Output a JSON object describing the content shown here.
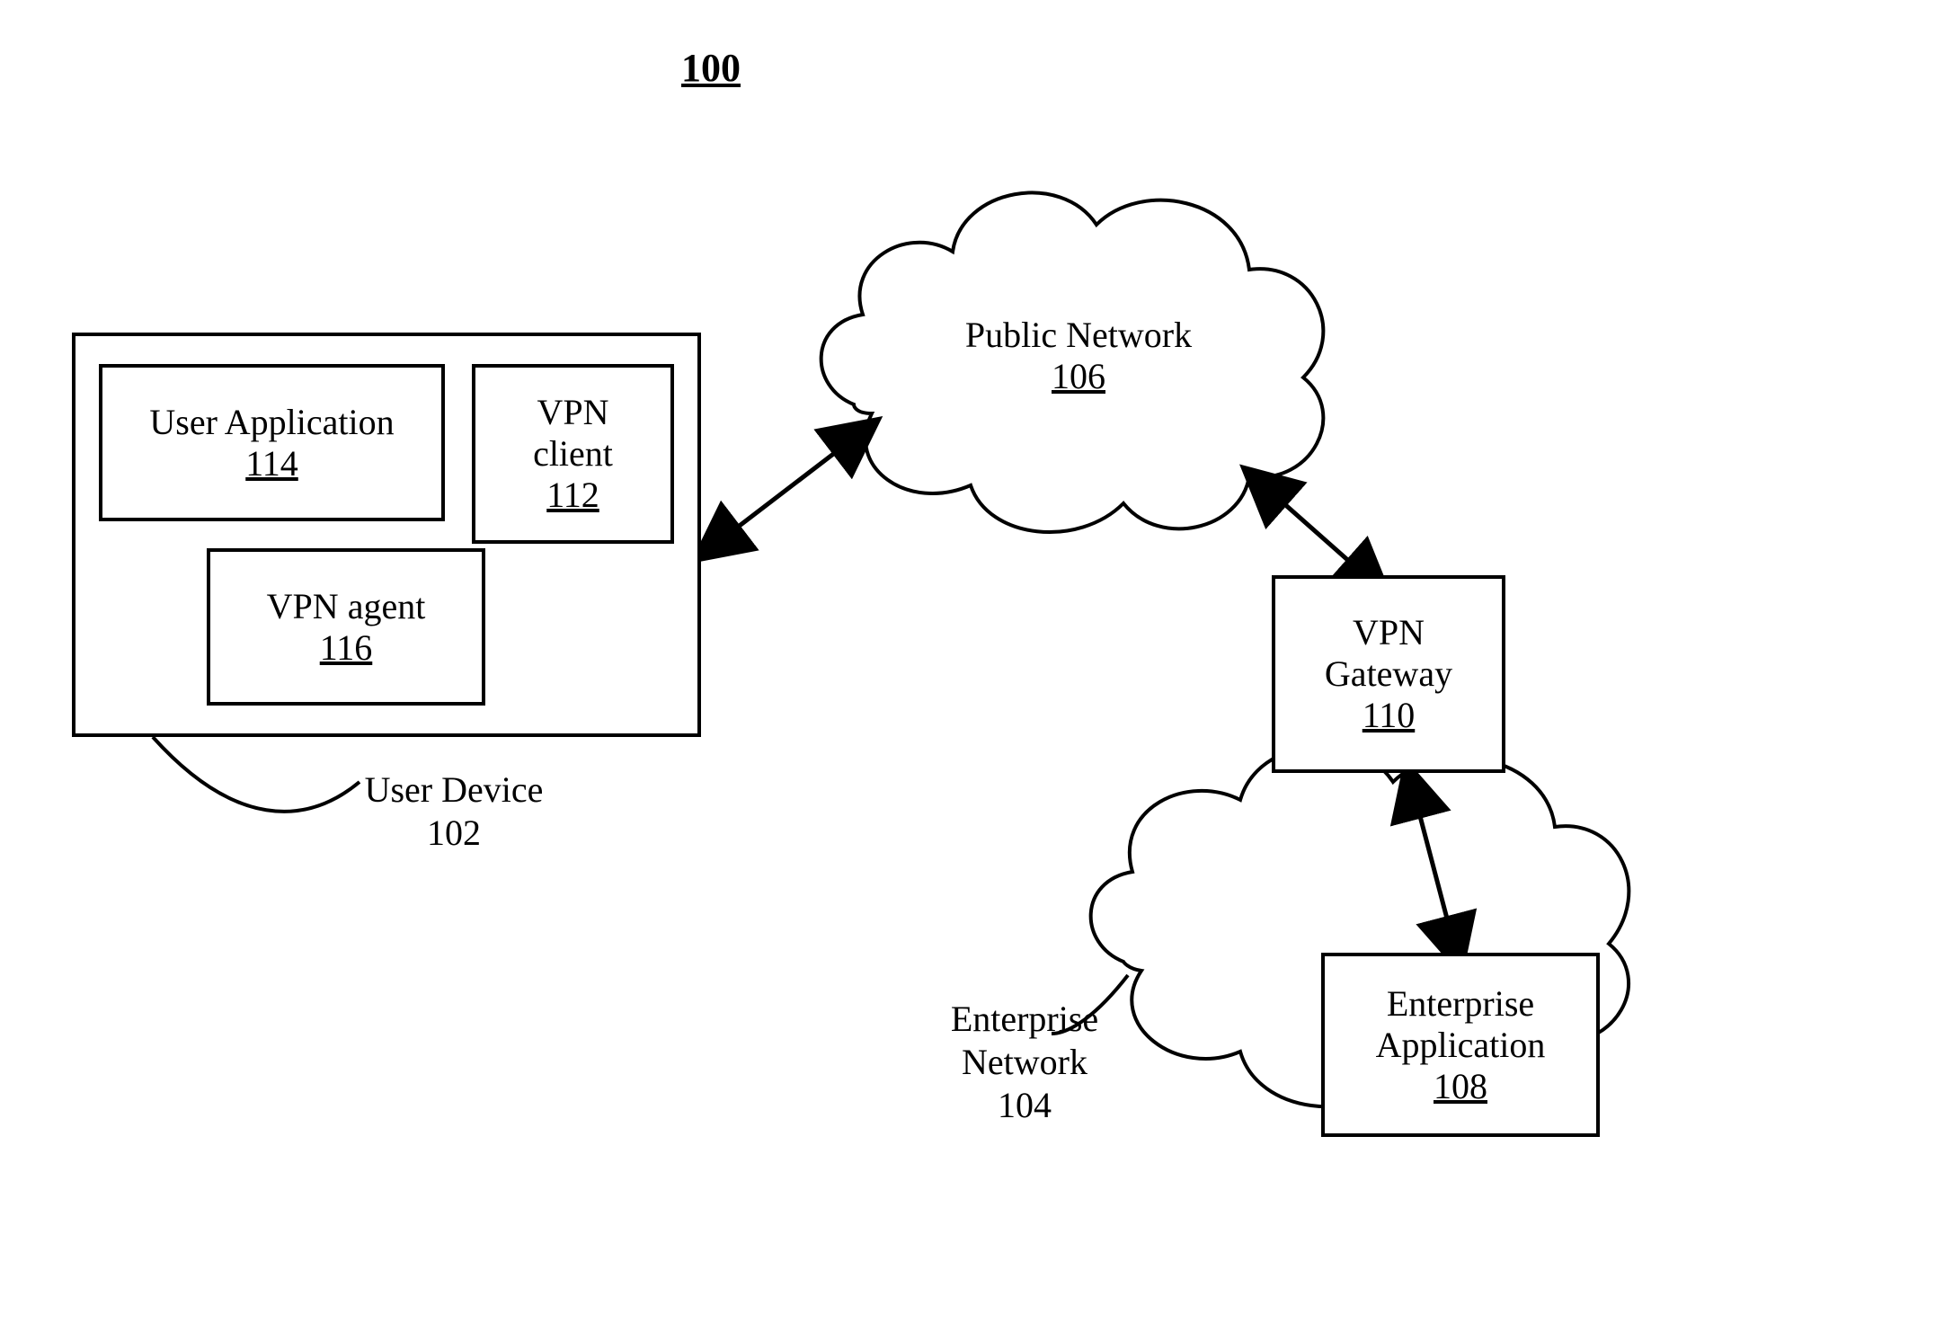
{
  "figure_number": "100",
  "user_device": {
    "label": "User Device",
    "ref": "102",
    "user_application": {
      "label": "User Application",
      "ref": "114"
    },
    "vpn_client": {
      "label": "VPN client",
      "ref": "112",
      "line2": "client",
      "line1": "VPN"
    },
    "vpn_agent": {
      "label": "VPN agent",
      "ref": "116"
    }
  },
  "public_network": {
    "label": "Public Network",
    "ref": "106"
  },
  "enterprise_network": {
    "label": "Enterprise Network",
    "ref": "104",
    "line1": "Enterprise",
    "line2": "Network"
  },
  "vpn_gateway": {
    "label": "VPN Gateway",
    "ref": "110",
    "line1": "VPN",
    "line2": "Gateway"
  },
  "enterprise_app": {
    "label": "Enterprise Application",
    "ref": "108",
    "line1": "Enterprise",
    "line2": "Application"
  }
}
